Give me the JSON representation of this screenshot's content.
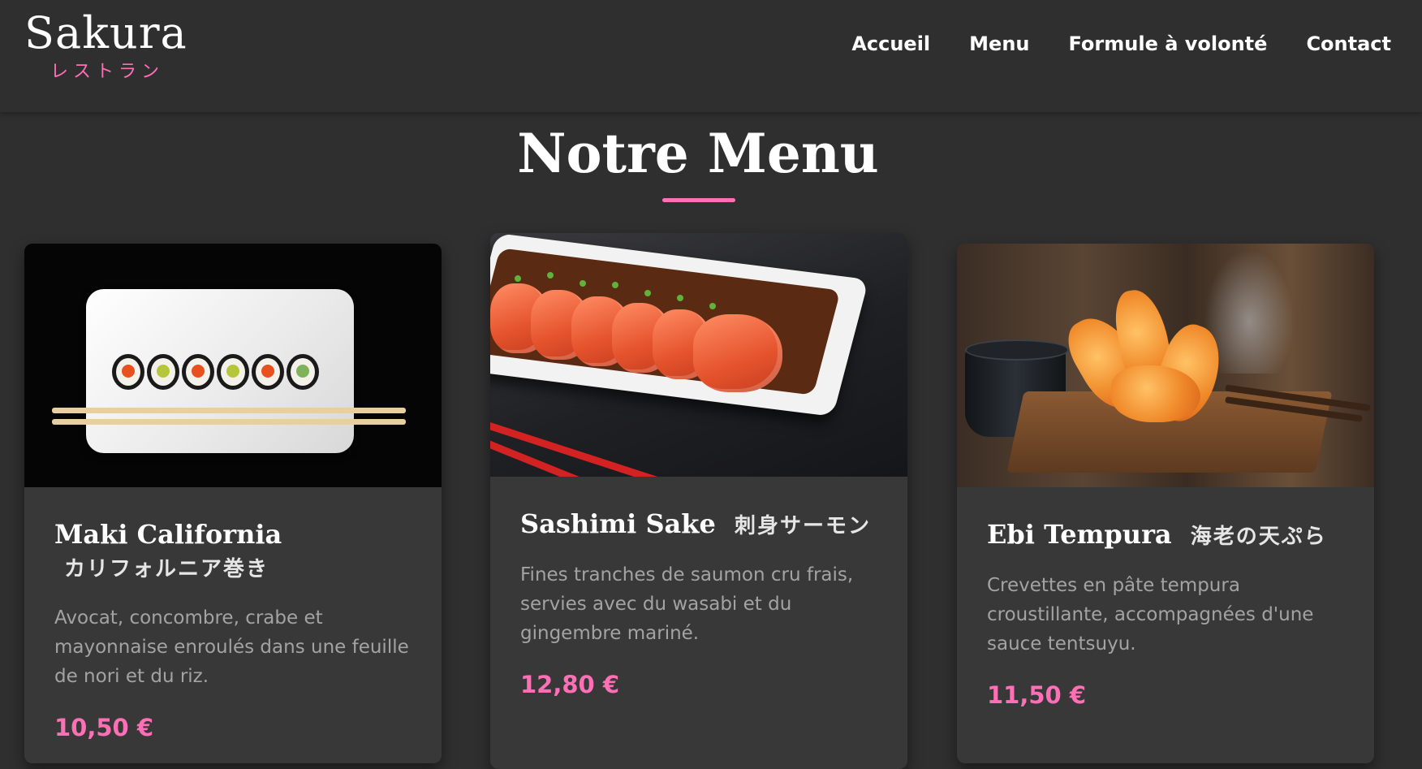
{
  "brand": {
    "name": "Sakura",
    "subtitle": "レストラン",
    "accent_color": "#ff6fb5"
  },
  "nav": {
    "items": [
      {
        "label": "Accueil"
      },
      {
        "label": "Menu"
      },
      {
        "label": "Formule à volonté"
      },
      {
        "label": "Contact"
      }
    ]
  },
  "section": {
    "title": "Notre Menu"
  },
  "menu": {
    "items": [
      {
        "name": "Maki California",
        "name_jp": "カリフォルニア巻き",
        "description": "Avocat, concombre, crabe et mayonnaise enroulés dans une feuille de nori et du riz.",
        "price": "10,50 €",
        "image_icon": "maki-rolls-photo"
      },
      {
        "name": "Sashimi Sake",
        "name_jp": "刺身サーモン",
        "description": "Fines tranches de saumon cru frais, servies avec du wasabi et du gingembre mariné.",
        "price": "12,80 €",
        "image_icon": "salmon-sashimi-photo"
      },
      {
        "name": "Ebi Tempura",
        "name_jp": "海老の天ぷら",
        "description": "Crevettes en pâte tempura croustillante, accompagnées d'une sauce tentsuyu.",
        "price": "11,50 €",
        "image_icon": "shrimp-tempura-photo"
      }
    ]
  }
}
